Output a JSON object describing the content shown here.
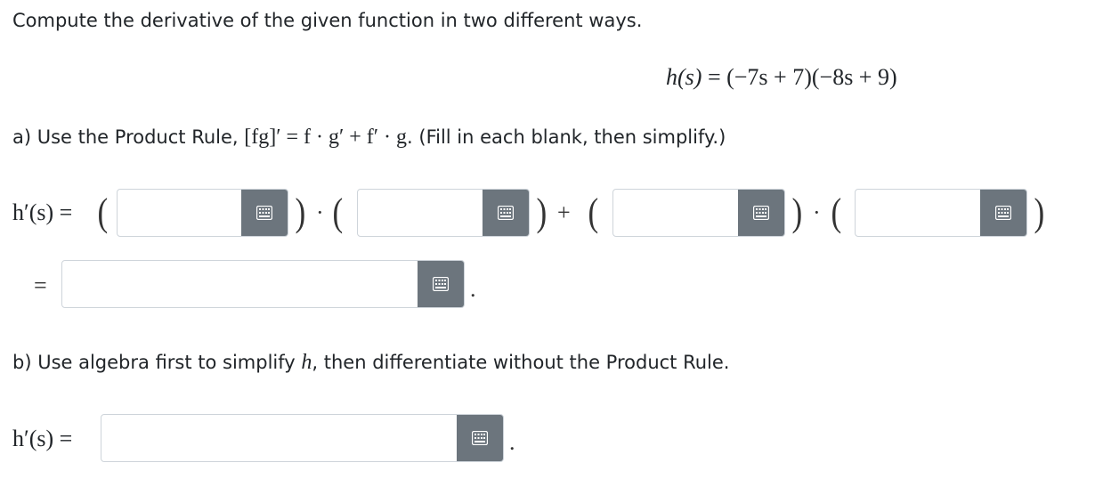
{
  "prompt": "Compute the derivative of the given function in two different ways.",
  "function_display": {
    "lhs": "h(s)",
    "equals": "=",
    "rhs": "(−7s + 7)(−8s + 9)"
  },
  "part_a": {
    "label_start": "a) Use the Product Rule, ",
    "rule": "[fg]′ = f · g′ + f′ · g",
    "label_end": ". (Fill in each blank, then simplify.)",
    "lhs": "h′(s) =",
    "dot": "·",
    "plus": "+",
    "paren_open": "(",
    "paren_close": ")",
    "simplified_equals": "=",
    "period": "."
  },
  "part_b": {
    "label_start": "b) Use algebra first to simplify ",
    "var": "h",
    "label_end": ", then differentiate without the Product Rule.",
    "lhs": "h′(s) =",
    "period": "."
  },
  "fields": {
    "f": "",
    "g_prime": "",
    "f_prime": "",
    "g": "",
    "simplified": "",
    "part_b_answer": ""
  },
  "icon": "keyboard-icon",
  "colors": {
    "button_bg": "#6c757d",
    "field_border": "#ced4da",
    "text": "#212529"
  }
}
